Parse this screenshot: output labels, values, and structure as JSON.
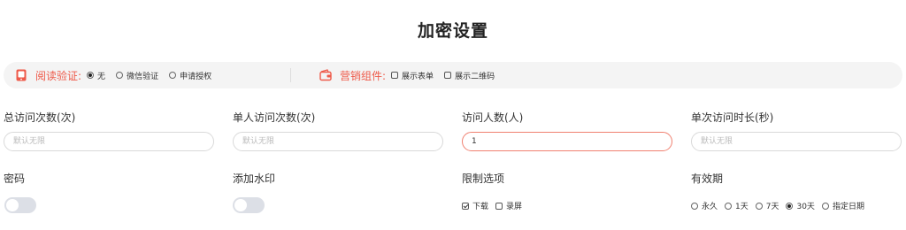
{
  "page": {
    "title": "加密设置"
  },
  "bar": {
    "reading": {
      "label": "阅读验证:",
      "options": [
        {
          "label": "无",
          "selected": true
        },
        {
          "label": "微信验证",
          "selected": false
        },
        {
          "label": "申请授权",
          "selected": false
        }
      ]
    },
    "marketing": {
      "label": "营销组件:",
      "options": [
        {
          "label": "展示表单",
          "checked": false
        },
        {
          "label": "展示二维码",
          "checked": false
        }
      ]
    }
  },
  "fields": {
    "total_visits": {
      "label": "总访问次数(次)",
      "placeholder": "默认无限",
      "value": ""
    },
    "per_person_visits": {
      "label": "单人访问次数(次)",
      "placeholder": "默认无限",
      "value": ""
    },
    "visitors": {
      "label": "访问人数(人)",
      "placeholder": "",
      "value": "1"
    },
    "single_duration": {
      "label": "单次访问时长(秒)",
      "placeholder": "默认无限",
      "value": ""
    }
  },
  "password": {
    "label": "密码",
    "enabled": false
  },
  "watermark": {
    "label": "添加水印",
    "enabled": false
  },
  "restrictions": {
    "label": "限制选项",
    "options": [
      {
        "label": "下载",
        "checked": true
      },
      {
        "label": "录屏",
        "checked": false
      }
    ]
  },
  "validity": {
    "label": "有效期",
    "options": [
      {
        "label": "永久",
        "selected": false
      },
      {
        "label": "1天",
        "selected": false
      },
      {
        "label": "7天",
        "selected": false
      },
      {
        "label": "30天",
        "selected": true
      },
      {
        "label": "指定日期",
        "selected": false
      }
    ]
  },
  "colors": {
    "accent": "#ee5a4a",
    "bar_bg": "#f4f4f4",
    "toggle_off": "#dcdfe6"
  }
}
